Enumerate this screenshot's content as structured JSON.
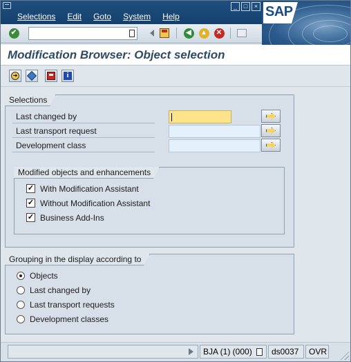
{
  "menubar": {
    "items": [
      "Selections",
      "Edit",
      "Goto",
      "System",
      "Help"
    ],
    "brand": "SAP",
    "window_controls": [
      "_",
      "□",
      "×"
    ]
  },
  "toolbar": {
    "command_field_value": "",
    "icons": [
      "enter-icon",
      "save-icon",
      "back-icon",
      "exit-icon",
      "cancel-icon",
      "print-icon"
    ]
  },
  "title": "Modification Browser: Object selection",
  "app_toolbar": {
    "icons": [
      "execute-icon",
      "choose-icon",
      "save-variant-icon",
      "info-icon"
    ]
  },
  "selections": {
    "heading": "Selections",
    "fields": [
      {
        "label": "Last changed by",
        "value": ""
      },
      {
        "label": "Last transport request",
        "value": ""
      },
      {
        "label": "Development class",
        "value": ""
      }
    ],
    "modified": {
      "heading": "Modified objects and enhancements",
      "options": [
        {
          "label": "With Modification Assistant",
          "checked": true
        },
        {
          "label": "Without Modification Assistant",
          "checked": true
        },
        {
          "label": "Business Add-Ins",
          "checked": true
        }
      ]
    }
  },
  "grouping": {
    "heading": "Grouping in the display according to",
    "options": [
      {
        "label": "Objects",
        "selected": true
      },
      {
        "label": "Last changed by",
        "selected": false
      },
      {
        "label": "Last transport requests",
        "selected": false
      },
      {
        "label": "Development classes",
        "selected": false
      }
    ]
  },
  "statusbar": {
    "system": "BJA (1) (000)",
    "server": "ds0037",
    "mode": "OVR"
  },
  "colors": {
    "menubar": "#14406e",
    "focused_field": "#fde48a",
    "input_field": "#e4f0fb",
    "title_text": "#2f4a66"
  }
}
